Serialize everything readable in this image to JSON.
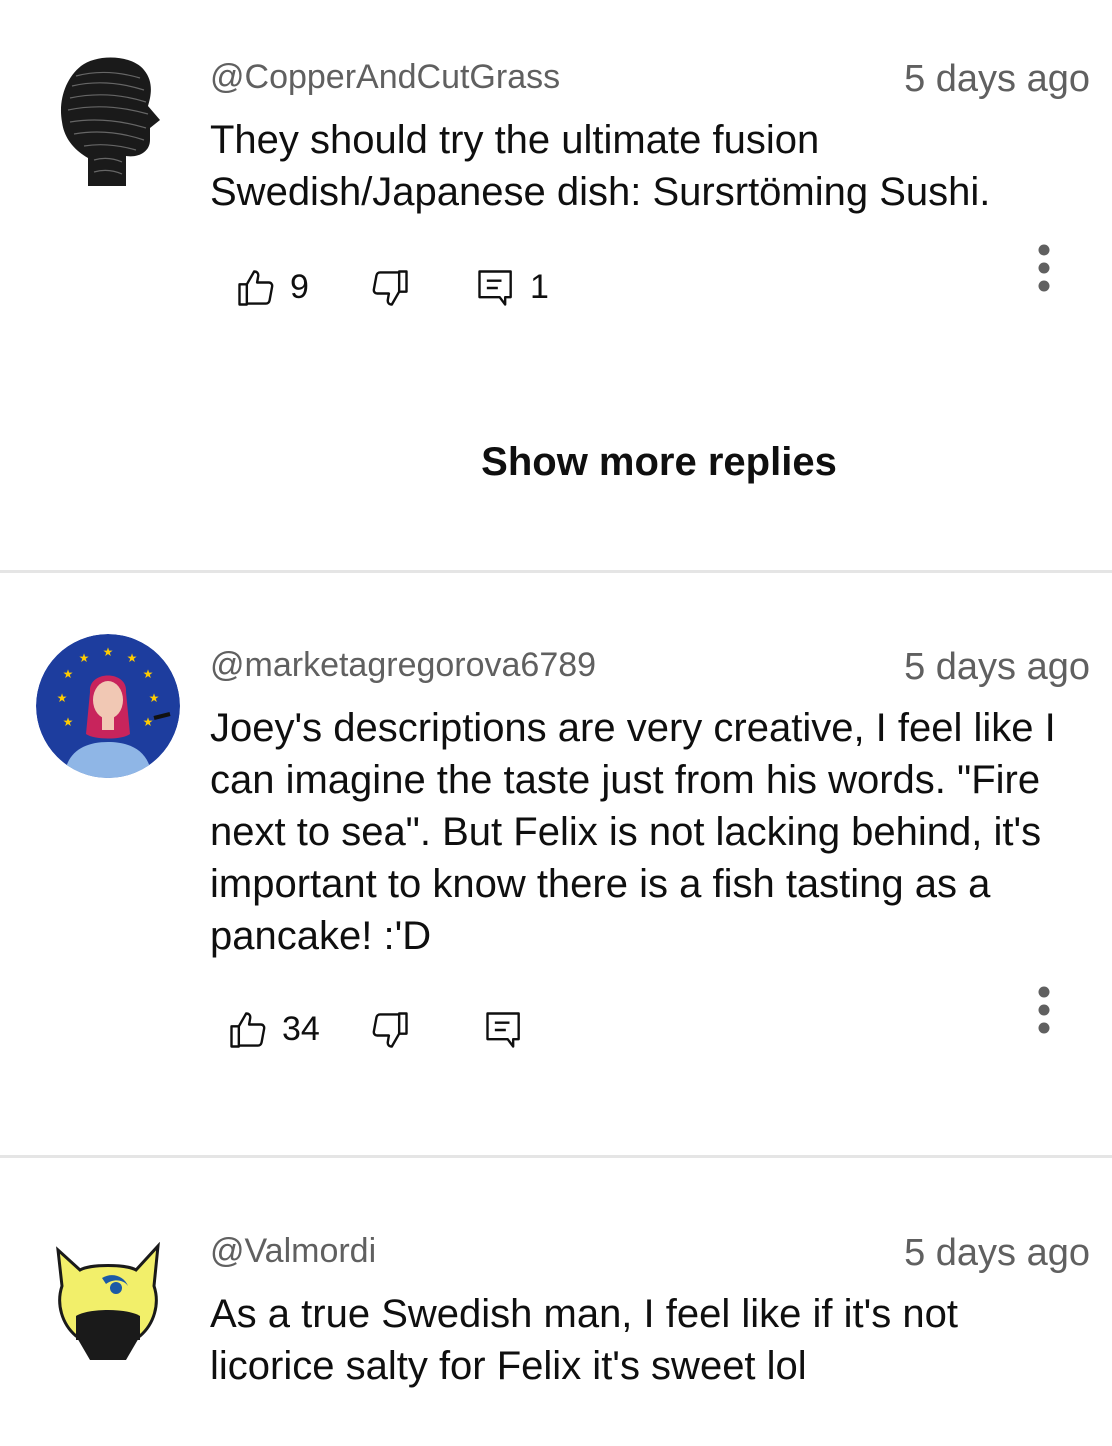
{
  "comments": [
    {
      "handle": "@CopperAndCutGrass",
      "time": "5 days ago",
      "text": "They should try the ultimate fusion Swedish/Japanese dish:  Sursrtöming Sushi.",
      "likes": "9",
      "replies": "1",
      "avatar_icon": "swirl-silhouette-avatar"
    },
    {
      "handle": "@marketagregorova6789",
      "time": "5 days ago",
      "text": "Joey's descriptions are very creative, I feel like I can imagine the taste just from his words. \"Fire next to sea\". But Felix is not lacking behind, it's important to know there is a fish tasting as a pancake! :'D",
      "likes": "34",
      "replies": "",
      "avatar_icon": "eu-flag-portrait-avatar"
    },
    {
      "handle": "@Valmordi",
      "time": "5 days ago",
      "text": "As a true Swedish man, I feel like if it's not licorice salty for Felix it's sweet lol",
      "avatar_icon": "yellow-cat-helmet-avatar"
    }
  ],
  "show_more_replies": "Show more replies",
  "colors": {
    "secondary_text": "#606060",
    "primary_text": "#0f0f0f",
    "divider": "#e5e5e5",
    "eu_blue": "#003399",
    "eu_star": "#ffcc00"
  },
  "icons": [
    "thumbs-up-icon",
    "thumbs-down-icon",
    "reply-icon",
    "more-vert-icon"
  ]
}
